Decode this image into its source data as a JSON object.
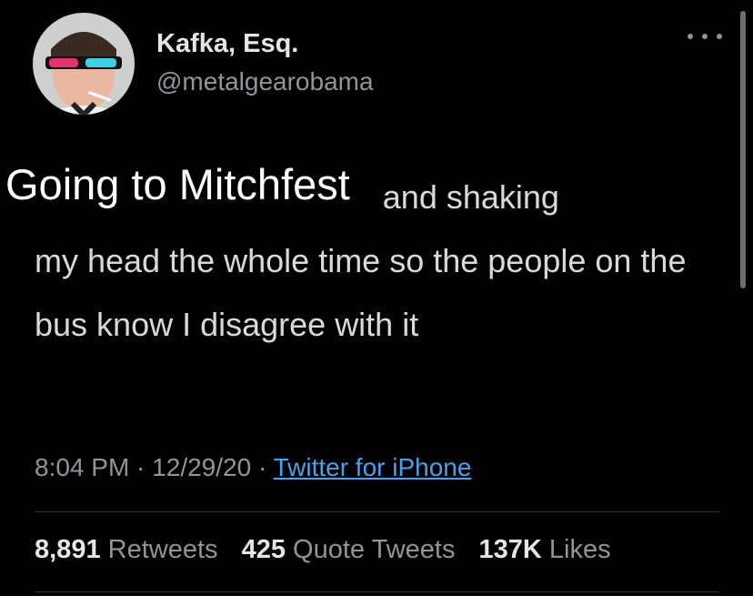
{
  "tweet": {
    "author": {
      "name": "Kafka, Esq.",
      "handle": "@metalgearobama"
    },
    "caption_overlay": "Going to Mitchfest",
    "text_line1_rest": " and shaking",
    "text_rest": "my head the whole time so the people on the bus know I disagree with it",
    "meta": {
      "time": "8:04 PM",
      "sep1": " · ",
      "date": "12/29/20",
      "sep2": " · ",
      "source": "Twitter for iPhone"
    },
    "stats": [
      {
        "value": "8,891",
        "label": "Retweets"
      },
      {
        "value": "425",
        "label": "Quote Tweets"
      },
      {
        "value": "137K",
        "label": "Likes"
      }
    ]
  },
  "colors": {
    "background": "#000000",
    "text": "#d9d9d9",
    "secondary": "#8f959a",
    "link": "#4aa1eb"
  }
}
